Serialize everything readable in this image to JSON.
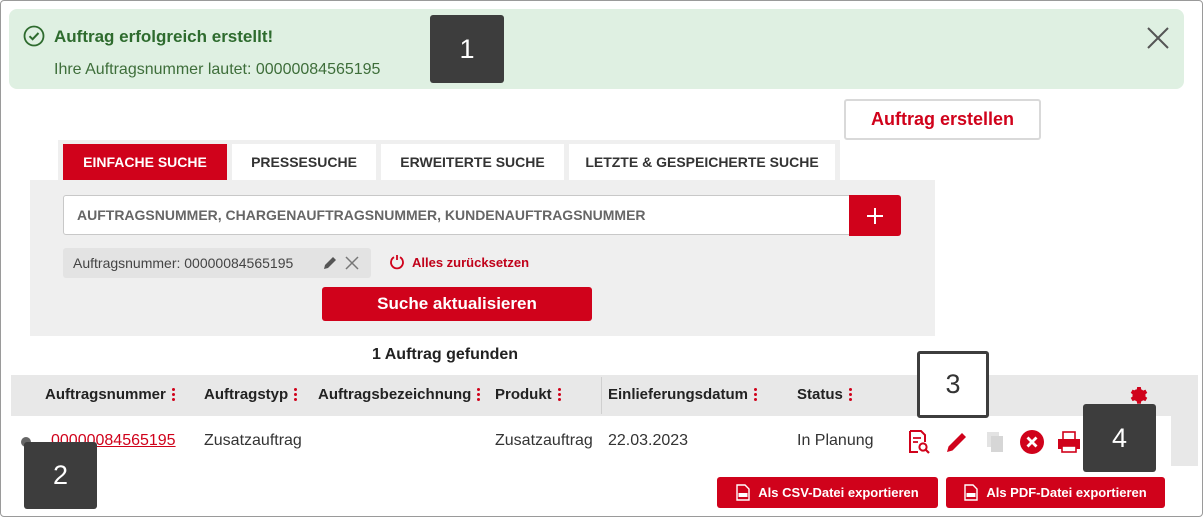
{
  "banner": {
    "title": "Auftrag erfolgreich erstellt!",
    "message": "Ihre Auftragsnummer lautet: 00000084565195",
    "icon": "check-circle-icon",
    "close_icon": "close-icon"
  },
  "markers": [
    "1",
    "2",
    "3",
    "4"
  ],
  "create_button": "Auftrag erstellen",
  "tabs": [
    {
      "label": "EINFACHE SUCHE",
      "active": true
    },
    {
      "label": "PRESSESUCHE",
      "active": false
    },
    {
      "label": "ERWEITERTE SUCHE",
      "active": false
    },
    {
      "label": "LETZTE & GESPEICHERTE SUCHE",
      "active": false
    }
  ],
  "search": {
    "placeholder": "AUFTRAGSNUMMER, CHARGENAUFTRAGSNUMMER, KUNDENAUFTRAGSNUMMER",
    "add_icon": "plus-icon"
  },
  "filter_chip": "Auftragsnummer: 00000084565195",
  "reset_label": "Alles zurücksetzen",
  "update_button": "Suche aktualisieren",
  "result_count": "1 Auftrag gefunden",
  "table": {
    "columns": [
      "Auftragsnummer",
      "Auftragstyp",
      "Auftragsbezeichnung",
      "Produkt",
      "Einlieferungsdatum",
      "Status"
    ],
    "rows": [
      {
        "auftragsnummer": "00000084565195",
        "auftragstyp": "Zusatzauftrag",
        "auftragsbezeichnung": "",
        "produkt": "Zusatzauftrag",
        "einlieferungsdatum": "22.03.2023",
        "status": "In Planung"
      }
    ],
    "row_actions": [
      "details-icon",
      "edit-icon",
      "copy-icon",
      "cancel-icon",
      "print-icon"
    ],
    "settings_icon": "gear-icon"
  },
  "export": {
    "csv": "Als CSV-Datei exportieren",
    "pdf": "Als PDF-Datei exportieren"
  },
  "colors": {
    "brand_red": "#d0021b",
    "success_bg": "#dff0e2",
    "success_text": "#2e6b2e",
    "panel_gray": "#efefef"
  }
}
